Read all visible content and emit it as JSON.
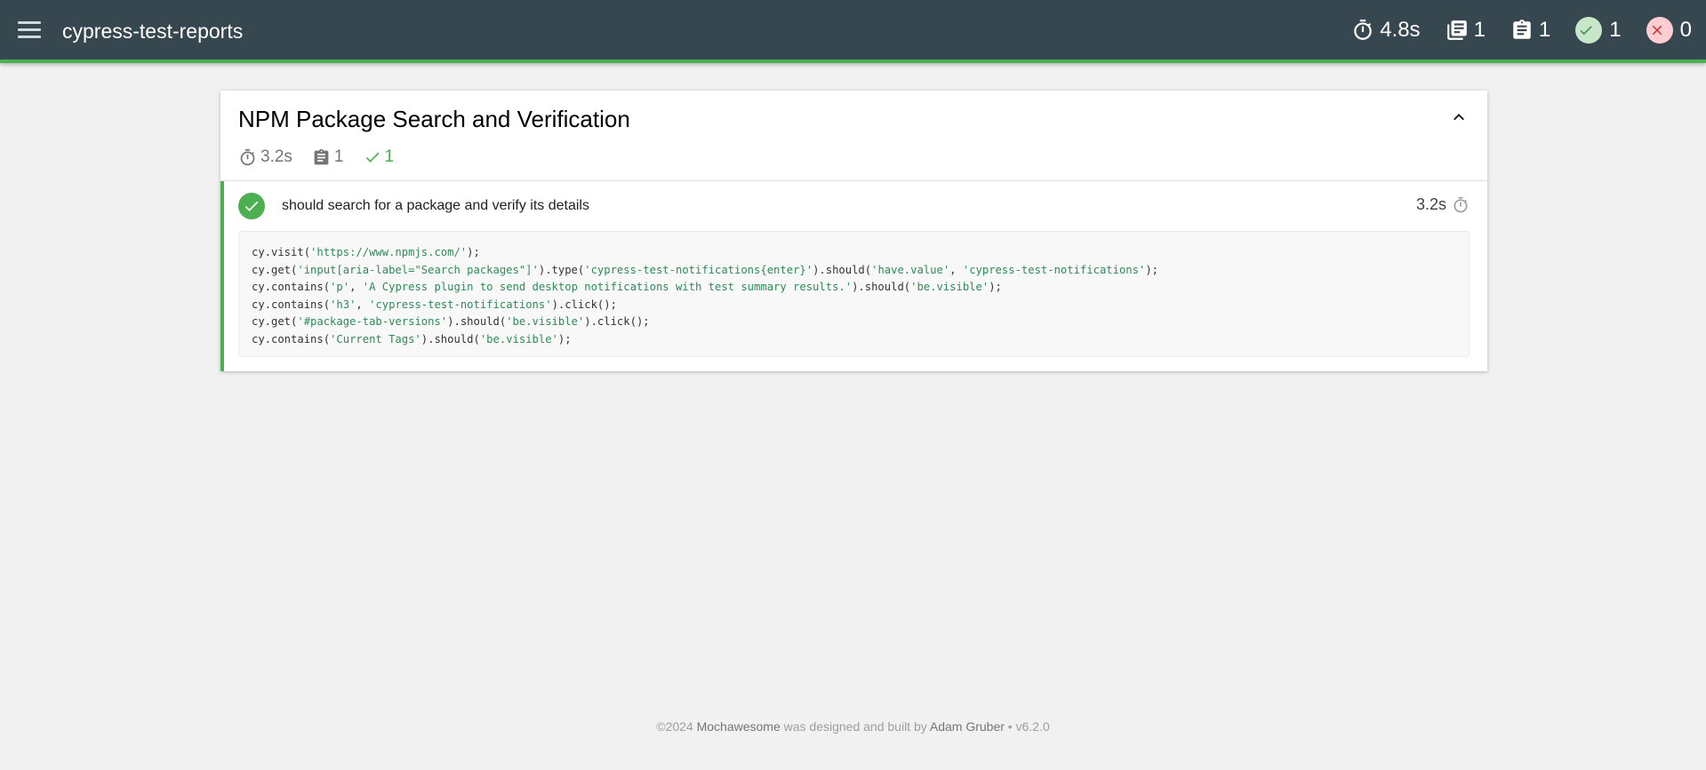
{
  "navbar": {
    "title": "cypress-test-reports",
    "stats": {
      "duration": "4.8s",
      "suites": "1",
      "tests": "1",
      "passes": "1",
      "failures": "0"
    }
  },
  "suite": {
    "title": "NPM Package Search and Verification",
    "stats": {
      "duration": "3.2s",
      "tests": "1",
      "passes": "1"
    },
    "test": {
      "title": "should search for a package and verify its details",
      "duration": "3.2s",
      "status": "passed",
      "code": [
        [
          {
            "t": "cy.visit("
          },
          {
            "t": "'https://www.npmjs.com/'",
            "s": 1
          },
          {
            "t": ");"
          }
        ],
        [
          {
            "t": "cy.get("
          },
          {
            "t": "'input[aria-label=\"Search packages\"]'",
            "s": 1
          },
          {
            "t": ").type("
          },
          {
            "t": "'cypress-test-notifications{enter}'",
            "s": 1
          },
          {
            "t": ").should("
          },
          {
            "t": "'have.value'",
            "s": 1
          },
          {
            "t": ", "
          },
          {
            "t": "'cypress-test-notifications'",
            "s": 1
          },
          {
            "t": ");"
          }
        ],
        [
          {
            "t": "cy.contains("
          },
          {
            "t": "'p'",
            "s": 1
          },
          {
            "t": ", "
          },
          {
            "t": "'A Cypress plugin to send desktop notifications with test summary results.'",
            "s": 1
          },
          {
            "t": ").should("
          },
          {
            "t": "'be.visible'",
            "s": 1
          },
          {
            "t": ");"
          }
        ],
        [
          {
            "t": "cy.contains("
          },
          {
            "t": "'h3'",
            "s": 1
          },
          {
            "t": ", "
          },
          {
            "t": "'cypress-test-notifications'",
            "s": 1
          },
          {
            "t": ").click();"
          }
        ],
        [
          {
            "t": "cy.get("
          },
          {
            "t": "'#package-tab-versions'",
            "s": 1
          },
          {
            "t": ").should("
          },
          {
            "t": "'be.visible'",
            "s": 1
          },
          {
            "t": ").click();"
          }
        ],
        [
          {
            "t": "cy.contains("
          },
          {
            "t": "'Current Tags'",
            "s": 1
          },
          {
            "t": ").should("
          },
          {
            "t": "'be.visible'",
            "s": 1
          },
          {
            "t": ");"
          }
        ]
      ]
    }
  },
  "footer": {
    "prefix": "©2024 ",
    "brand": "Mochawesome",
    "middle": " was designed and built by ",
    "author": "Adam Gruber",
    "suffix": " • v6.2.0"
  },
  "colors": {
    "navbar_bg": "#37474f",
    "accent_pass": "#4caf50",
    "fail": "#f44336",
    "string": "#2e8b57"
  },
  "icons": {
    "menu": "hamburger-menu-icon",
    "duration": "stopwatch-icon",
    "suites": "library-books-icon",
    "tests": "clipboard-icon",
    "passes": "check-circle-icon",
    "failures": "close-circle-icon",
    "collapse": "chevron-up-icon"
  }
}
